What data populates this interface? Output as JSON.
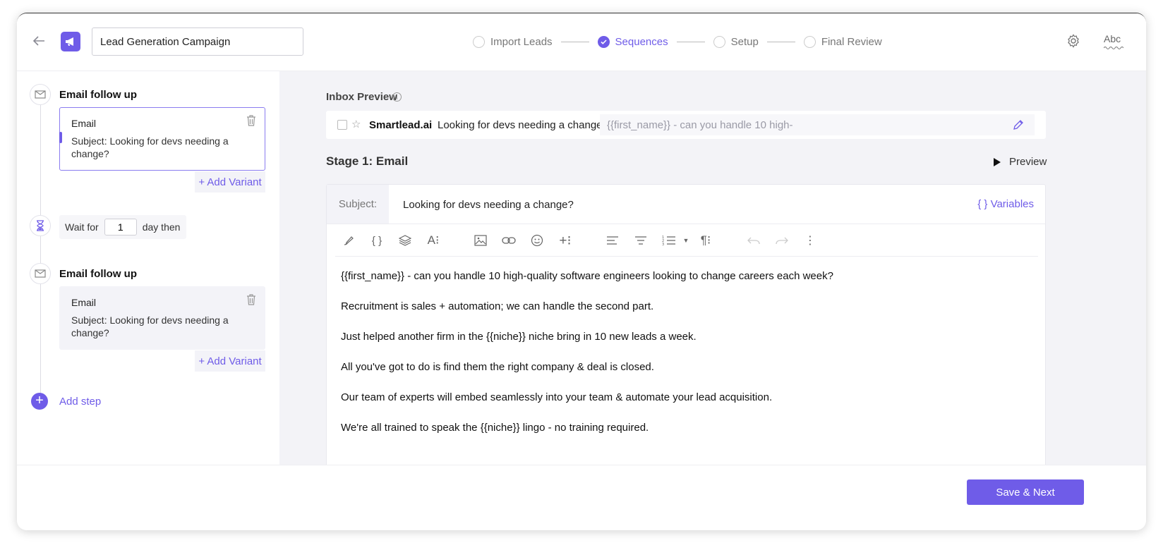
{
  "header": {
    "campaign_name": "Lead Generation Campaign",
    "steps": [
      {
        "label": "Import Leads",
        "state": "pending"
      },
      {
        "label": "Sequences",
        "state": "active"
      },
      {
        "label": "Setup",
        "state": "pending"
      },
      {
        "label": "Final Review",
        "state": "pending"
      }
    ],
    "spellcheck_label": "Abc"
  },
  "sequence": {
    "steps": [
      {
        "title": "Email follow up",
        "card_type": "Email",
        "card_subject": "Subject: Looking for devs needing a change?",
        "add_variant": "+ Add Variant"
      },
      {
        "title": "Email follow up",
        "card_type": "Email",
        "card_subject": "Subject: Looking for devs needing a change?",
        "add_variant": "+ Add Variant"
      }
    ],
    "wait": {
      "prefix": "Wait for",
      "value": "1",
      "suffix": "day then"
    },
    "add_step": "Add step"
  },
  "inbox_preview": {
    "title": "Inbox Preview",
    "sender": "Smartlead.ai",
    "subject": "Looking for devs needing a change?",
    "snippet": "{{first_name}} - can you handle 10 high-"
  },
  "stage": {
    "title": "Stage 1: Email",
    "preview_label": "Preview",
    "subject_label": "Subject:",
    "subject_value": "Looking for devs needing a change?",
    "variables_label": "{ } Variables",
    "body": [
      "{{first_name}} - can you handle 10 high-quality software engineers looking to change careers each week?",
      "Recruitment is sales + automation; we can handle the second part.",
      "Just helped another firm in the {{niche}} niche bring in 10 new leads a week.",
      "All you've got to do is find them the right company & deal is closed.",
      "Our team of experts will embed seamlessly into your team & automate your lead acquisition.",
      "We're all trained to speak the {{niche}} lingo - no training required."
    ]
  },
  "footer": {
    "save_label": "Save & Next"
  },
  "colors": {
    "accent": "#6f5ce8",
    "panel_bg": "#f3f3f7"
  }
}
